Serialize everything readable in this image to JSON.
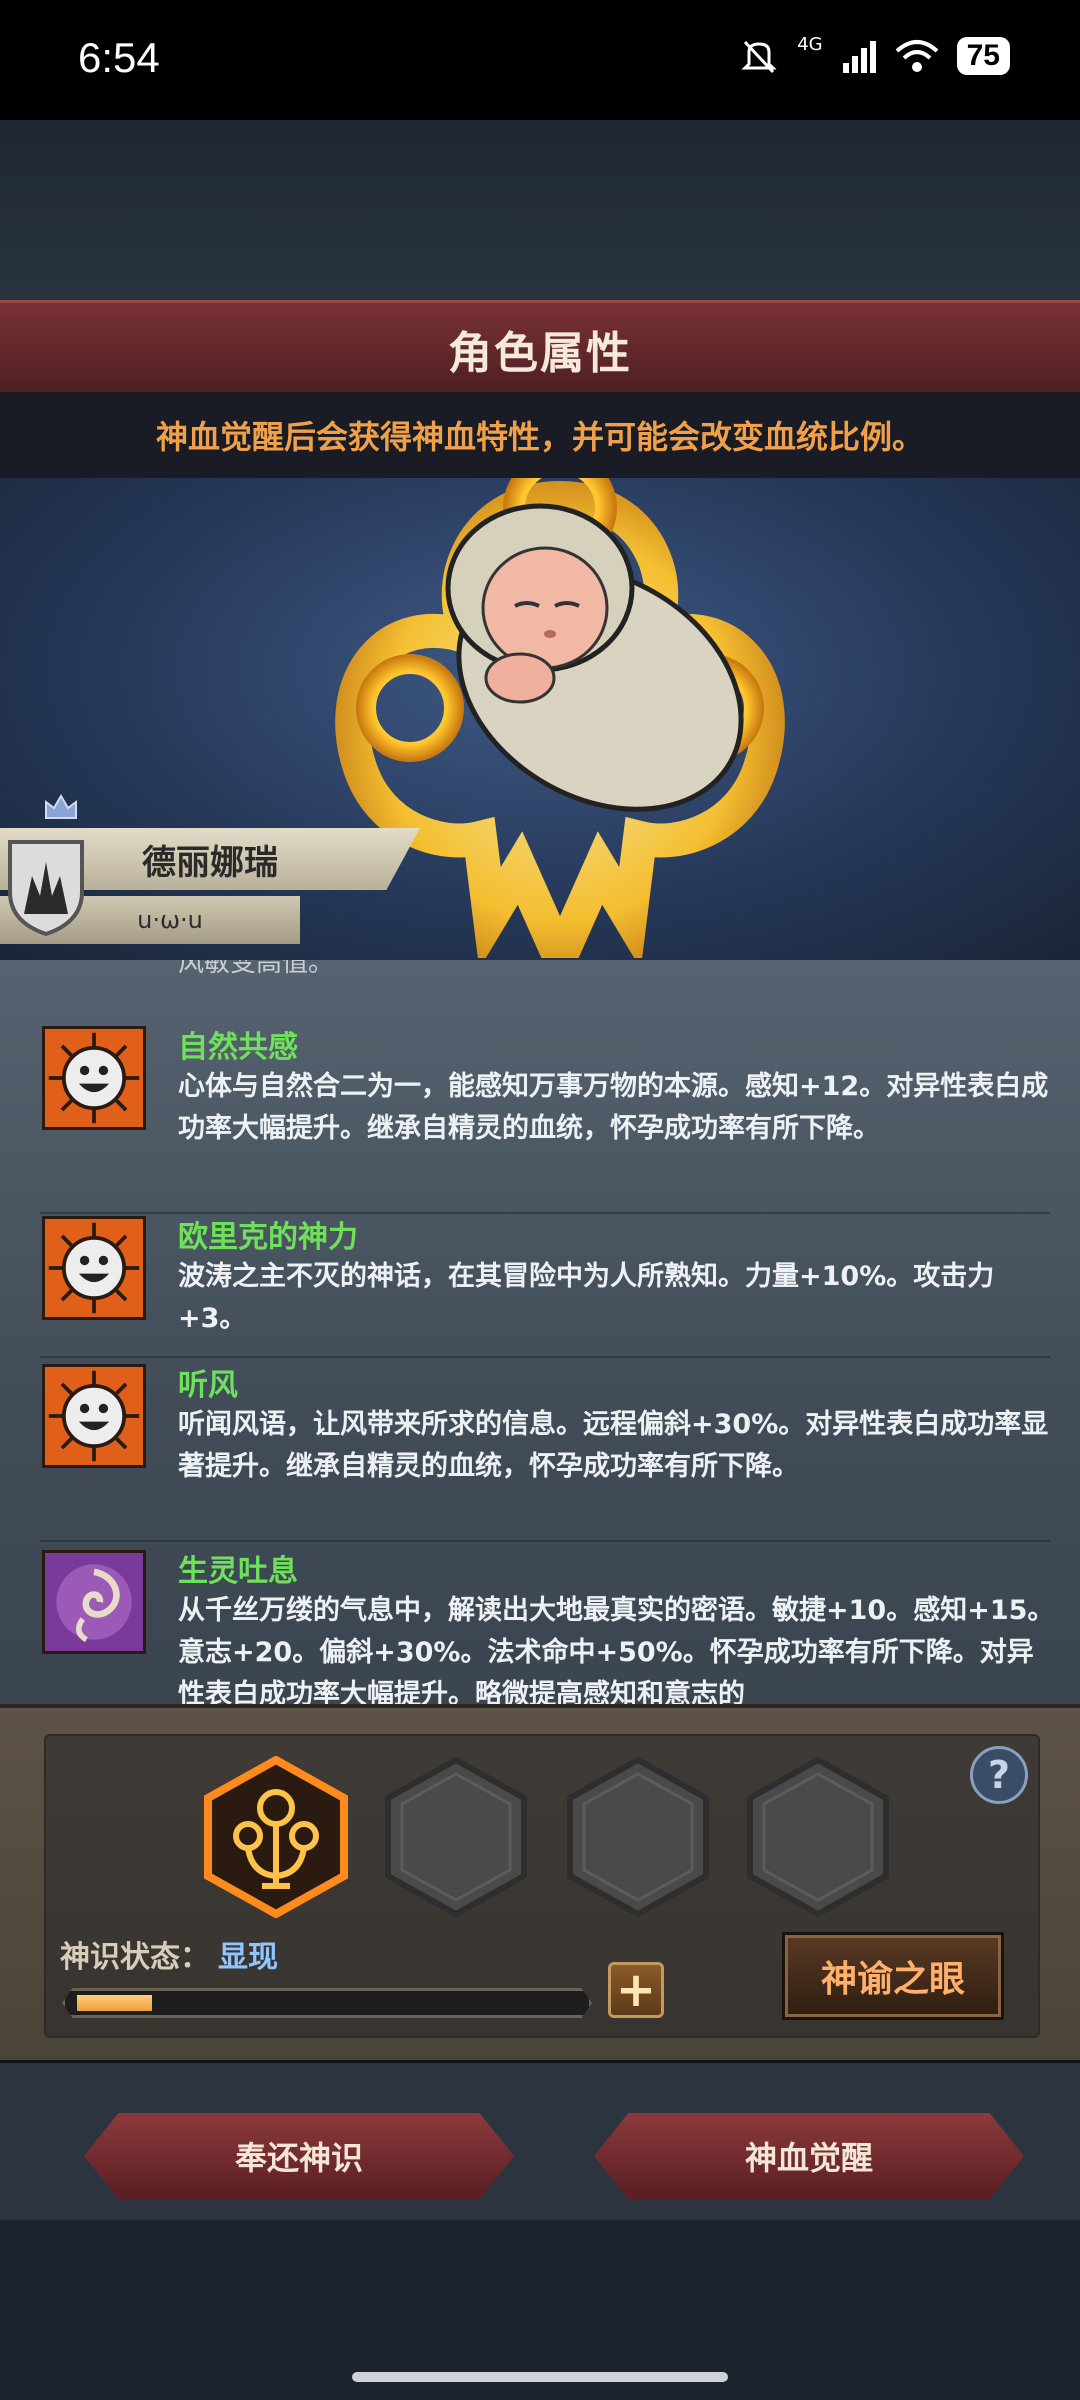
{
  "status_bar": {
    "time": "6:54",
    "network": "4G",
    "battery": "75"
  },
  "header": {
    "title": "角色属性"
  },
  "notice": {
    "text": "神血觉醒后会获得神血特性，并可能会改变血统比例。"
  },
  "character": {
    "name": "德丽娜瑞",
    "subtitle": "u·ω·u"
  },
  "traits": {
    "cutoff_text": "风敏变高值。",
    "items": [
      {
        "name": "自然共感",
        "description": "心体与自然合二为一，能感知万事万物的本源。感知+12。对异性表白成功率大幅提升。继承自精灵的血统，怀孕成功率有所下降。",
        "icon": "smiley-sun-icon"
      },
      {
        "name": "欧里克的神力",
        "description": "波涛之主不灭的神话，在其冒险中为人所熟知。力量+10%。攻击力+3。",
        "icon": "smiley-sun-icon"
      },
      {
        "name": "听风",
        "description": "听闻风语，让风带来所求的信息。远程偏斜+30%。对异性表白成功率显著提升。继承自精灵的血统，怀孕成功率有所下降。",
        "icon": "smiley-sun-icon"
      },
      {
        "name": "生灵吐息",
        "description": "从千丝万缕的气息中，解读出大地最真实的密语。敏捷+10。感知+15。意志+20。偏斜+30%。法术命中+50%。怀孕成功率有所下降。对异性表白成功率大幅提升。略微提高感知和意志的",
        "icon": "breath-swirl-icon"
      }
    ]
  },
  "divine_panel": {
    "state_label": "神识状态：",
    "state_value": "显现",
    "progress": 0.15,
    "help_label": "?",
    "plus_label": "+",
    "oracle_button": "神谕之眼",
    "slots": [
      "divine-sigil-icon",
      "empty",
      "empty",
      "empty"
    ]
  },
  "actions": {
    "return_button": "奉还神识",
    "awaken_button": "神血觉醒"
  },
  "colors": {
    "accent_gold": "#f0a048",
    "trait_green": "#6fe05a",
    "state_blue": "#8fc6ff",
    "banner_red": "#7a3234"
  }
}
